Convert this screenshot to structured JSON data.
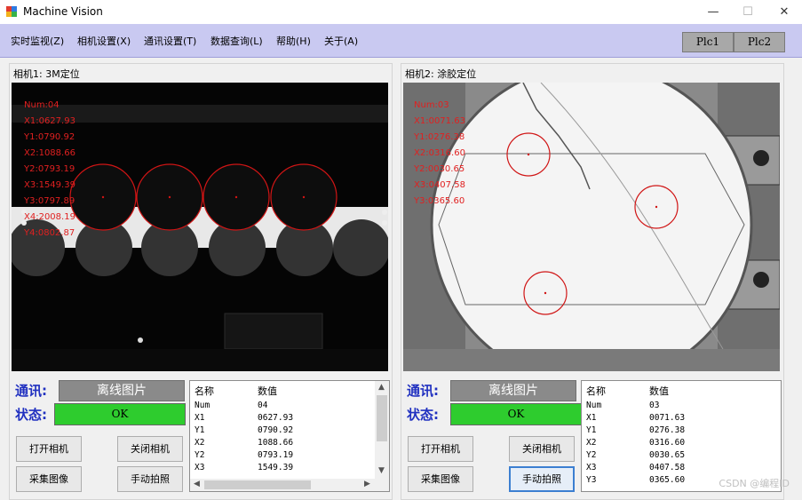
{
  "window": {
    "title": "Machine Vision",
    "minimize": "—",
    "maximize": "☐",
    "close": "✕"
  },
  "menu": [
    "实时监视(Z)",
    "相机设置(X)",
    "通讯设置(T)",
    "数据查询(L)",
    "帮助(H)",
    "关于(A)"
  ],
  "plc_buttons": [
    "Plc1",
    "Plc2"
  ],
  "camera1": {
    "title": "相机1:  3M定位",
    "overlay": [
      "Num:04",
      "X1:0627.93",
      "Y1:0790.92",
      "X2:1088.66",
      "Y2:0793.19",
      "X3:1549.39",
      "Y3:0797.89",
      "X4:2008.19",
      "Y4:0802.87"
    ],
    "comm_label": "通讯:",
    "comm_value": "离线图片",
    "status_label": "状态:",
    "status_value": "OK",
    "buttons": {
      "open": "打开相机",
      "close": "关闭相机",
      "capture": "采集图像",
      "manual": "手动拍照"
    },
    "table": {
      "headers": [
        "名称",
        "数值"
      ],
      "rows": [
        [
          "Num",
          "04"
        ],
        [
          "X1",
          "0627.93"
        ],
        [
          "Y1",
          "0790.92"
        ],
        [
          "X2",
          "1088.66"
        ],
        [
          "Y2",
          "0793.19"
        ],
        [
          "X3",
          "1549.39"
        ]
      ]
    }
  },
  "camera2": {
    "title": "相机2:  涂胶定位",
    "overlay": [
      "Num:03",
      "X1:0071.63",
      "Y1:0276.38",
      "X2:0316.60",
      "Y2:0030.65",
      "X3:0407.58",
      "Y3:0365.60"
    ],
    "comm_label": "通讯:",
    "comm_value": "离线图片",
    "status_label": "状态:",
    "status_value": "OK",
    "buttons": {
      "open": "打开相机",
      "close": "关闭相机",
      "capture": "采集图像",
      "manual": "手动拍照"
    },
    "table": {
      "headers": [
        "名称",
        "数值"
      ],
      "rows": [
        [
          "Num",
          "03"
        ],
        [
          "X1",
          "0071.63"
        ],
        [
          "Y1",
          "0276.38"
        ],
        [
          "X2",
          "0316.60"
        ],
        [
          "Y2",
          "0030.65"
        ],
        [
          "X3",
          "0407.58"
        ],
        [
          "Y3",
          "0365.60"
        ]
      ]
    }
  },
  "watermark": "CSDN @编程ID",
  "colors": {
    "menubar": "#c9c9f1",
    "ok_green": "#2ecc2e",
    "label_blue": "#2030c0",
    "overlay_red": "#e02020"
  }
}
